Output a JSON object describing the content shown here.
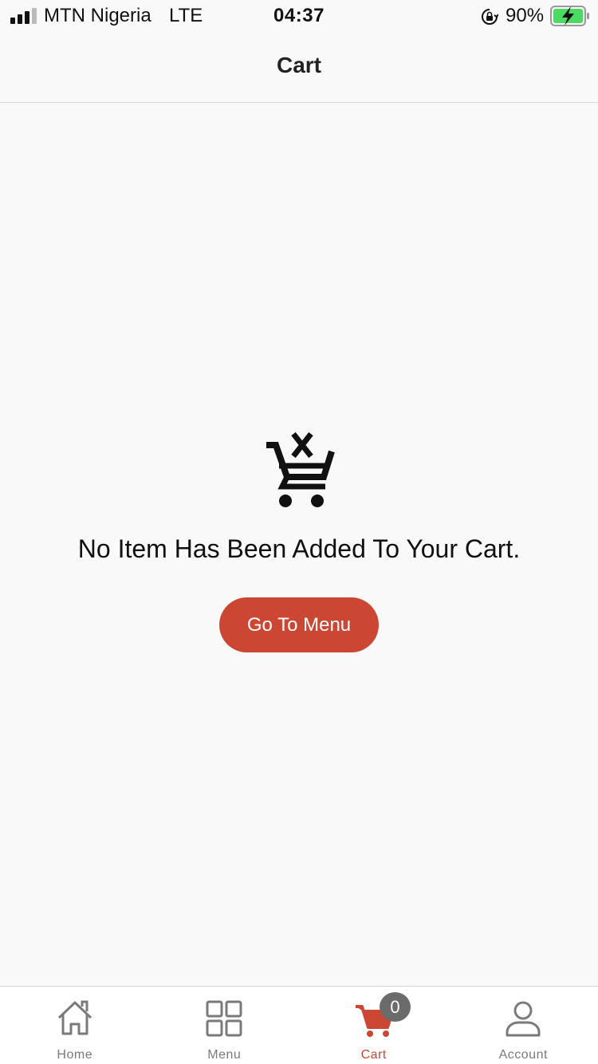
{
  "status_bar": {
    "carrier": "MTN Nigeria",
    "network": "LTE",
    "time": "04:37",
    "battery_percent": "90%"
  },
  "header": {
    "title": "Cart"
  },
  "empty_state": {
    "message": "No Item Has Been Added To Your Cart.",
    "button_label": "Go To Menu"
  },
  "colors": {
    "accent": "#cc4733",
    "badge": "#6b6b6b",
    "inactive": "#7a7a7a"
  },
  "tabs": [
    {
      "label": "Home",
      "icon": "home-icon"
    },
    {
      "label": "Menu",
      "icon": "grid-icon"
    },
    {
      "label": "Cart",
      "icon": "cart-icon",
      "active": true,
      "badge": "0"
    },
    {
      "label": "Account",
      "icon": "user-icon"
    }
  ]
}
